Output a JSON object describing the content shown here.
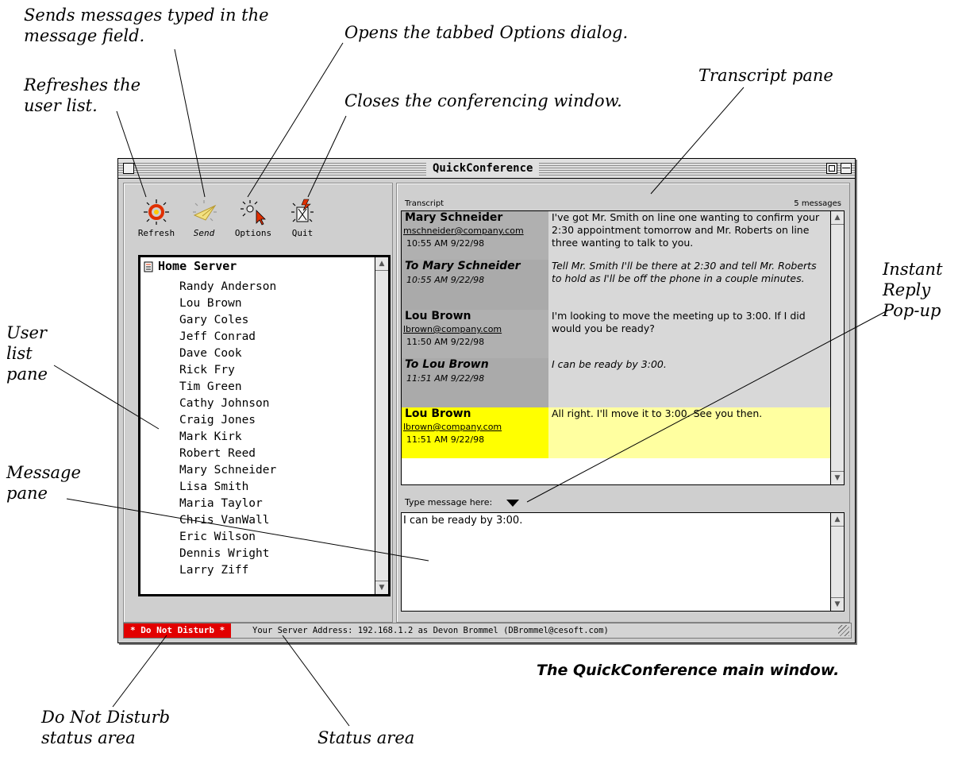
{
  "window": {
    "title": "QuickConference"
  },
  "toolbar": {
    "buttons": [
      {
        "label": "Refresh",
        "icon": "refresh-icon"
      },
      {
        "label": "Send",
        "icon": "send-icon"
      },
      {
        "label": "Options",
        "icon": "options-icon"
      },
      {
        "label": "Quit",
        "icon": "quit-icon"
      }
    ]
  },
  "user_list": {
    "server": "Home Server",
    "users": [
      "Randy Anderson",
      "Lou Brown",
      "Gary Coles",
      "Jeff Conrad",
      "Dave Cook",
      "Rick Fry",
      "Tim Green",
      "Cathy Johnson",
      "Craig Jones",
      "Mark Kirk",
      "Robert Reed",
      "Mary Schneider",
      "Lisa Smith",
      "Maria Taylor",
      "Chris VanWall",
      "Eric Wilson",
      "Dennis Wright",
      "Larry Ziff"
    ]
  },
  "transcript": {
    "label": "Transcript",
    "count": "5 messages",
    "messages": [
      {
        "name": "Mary Schneider",
        "email": "mschneider@company.com",
        "time": "10:55 AM 9/22/98",
        "text": "I've got Mr. Smith on line one wanting to confirm your 2:30 appointment tomorrow and Mr. Roberts on line three wanting to talk to you."
      },
      {
        "name": "To Mary Schneider",
        "email": "",
        "time": "10:55 AM 9/22/98",
        "text": "Tell Mr. Smith I'll be there at 2:30 and tell Mr. Roberts to hold as I'll be off the phone in a couple minutes."
      },
      {
        "name": "Lou Brown",
        "email": "lbrown@company.com",
        "time": "11:50 AM 9/22/98",
        "text": "I'm looking to move the meeting up to 3:00. If I did would you be ready?"
      },
      {
        "name": "To Lou Brown",
        "email": "",
        "time": "11:51 AM 9/22/98",
        "text": "I can be ready by 3:00."
      },
      {
        "name": "Lou Brown",
        "email": "lbrown@company.com",
        "time": "11:51 AM 9/22/98",
        "text": "All right. I'll move it to 3:00. See you then."
      }
    ]
  },
  "message_field": {
    "label": "Type message here:",
    "value": "I can be ready by 3:00."
  },
  "status": {
    "dnd": "* Do Not Disturb *",
    "server_address": "Your Server Address: 192.168.1.2 as Devon Brommel (DBrommel@cesoft.com)"
  },
  "callouts": {
    "send": "Sends messages typed in the message field.",
    "options": "Opens the tabbed Options dialog.",
    "refresh": "Refreshes the user list.",
    "quit": "Closes the conferencing window.",
    "transcript": "Transcript pane",
    "instant_reply": "Instant Reply Pop-up",
    "user_list": "User list pane",
    "message": "Message pane",
    "dnd": "Do Not Disturb status area",
    "status": "Status area"
  },
  "caption": "The QuickConference main window.",
  "colors": {
    "dnd_red": "#e20000",
    "highlight_yellow": "#ffff00",
    "highlight_pale": "#ffffa0"
  }
}
